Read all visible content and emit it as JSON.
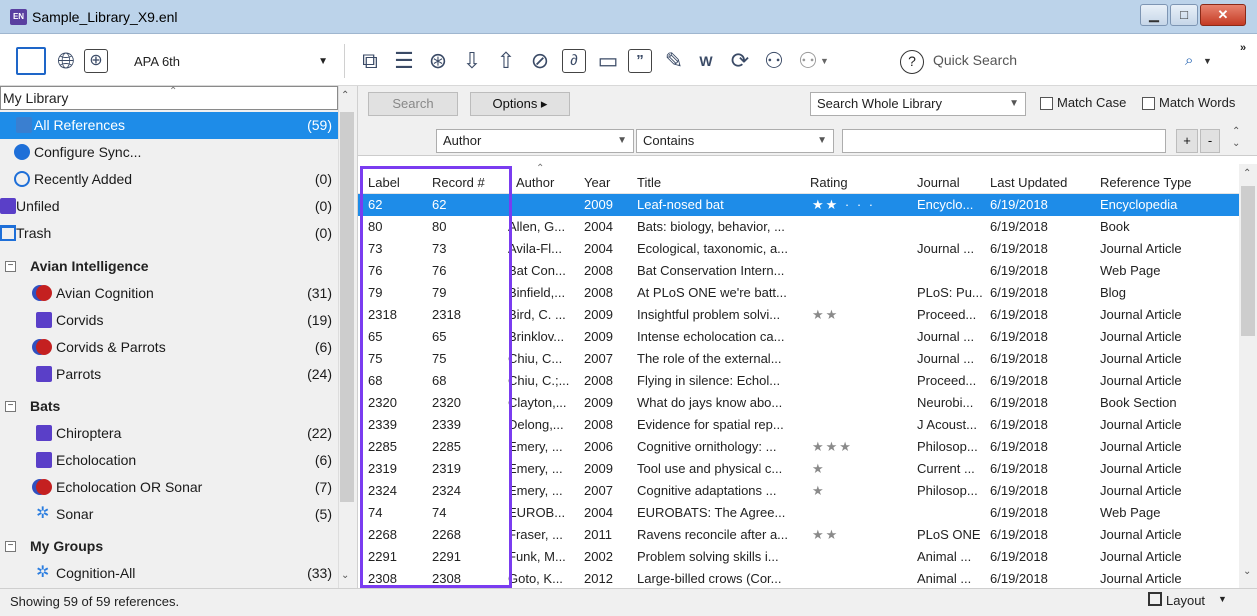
{
  "window": {
    "title": "Sample_Library_X9.enl",
    "app_badge": "EN"
  },
  "toolbar": {
    "style": "APA 6th",
    "quick_search_label": "Quick Search",
    "icons": [
      "local-library-icon",
      "online-search-icon",
      "integrated-library-icon",
      "copy-to-library-icon",
      "new-reference-icon",
      "find-full-text-icon",
      "import-icon",
      "export-icon",
      "online-search-find-icon",
      "open-link-icon",
      "open-file-icon",
      "insert-citation-icon",
      "format-bibliography-icon",
      "word-icon",
      "sync-icon",
      "share-library-icon",
      "manage-groups-icon",
      "help-icon",
      "search-icon"
    ]
  },
  "sidebar": {
    "library_select": "My Library",
    "items": [
      {
        "label": "All References",
        "count": "(59)",
        "icon": "all-references-icon"
      },
      {
        "label": "Configure Sync...",
        "count": "",
        "icon": "sync-icon"
      },
      {
        "label": "Recently Added",
        "count": "(0)",
        "icon": "clock-icon"
      },
      {
        "label": "Unfiled",
        "count": "(0)",
        "icon": "group-icon"
      },
      {
        "label": "Trash",
        "count": "(0)",
        "icon": "trash-icon"
      }
    ],
    "groups": [
      {
        "label": "Avian Intelligence",
        "items": [
          {
            "label": "Avian Cognition",
            "count": "(31)",
            "icon": "smart-group-icon"
          },
          {
            "label": "Corvids",
            "count": "(19)",
            "icon": "group-icon"
          },
          {
            "label": "Corvids & Parrots",
            "count": "(6)",
            "icon": "smart-group-icon"
          },
          {
            "label": "Parrots",
            "count": "(24)",
            "icon": "group-icon"
          }
        ]
      },
      {
        "label": "Bats",
        "items": [
          {
            "label": "Chiroptera",
            "count": "(22)",
            "icon": "group-icon"
          },
          {
            "label": "Echolocation",
            "count": "(6)",
            "icon": "group-icon"
          },
          {
            "label": "Echolocation OR Sonar",
            "count": "(7)",
            "icon": "smart-group-icon"
          },
          {
            "label": "Sonar",
            "count": "(5)",
            "icon": "gear-icon"
          }
        ]
      },
      {
        "label": "My Groups",
        "items": [
          {
            "label": "Cognition-All",
            "count": "(33)",
            "icon": "gear-icon"
          }
        ]
      }
    ]
  },
  "search": {
    "search_button": "Search",
    "options_button": "Options ▸",
    "scope": "Search Whole Library",
    "match_case": "Match Case",
    "match_words": "Match Words",
    "field": "Author",
    "operator": "Contains",
    "value": "",
    "add": "+",
    "remove": "-"
  },
  "table": {
    "columns": [
      "Label",
      "Record #",
      "Author",
      "Year",
      "Title",
      "Rating",
      "Journal",
      "Last Updated",
      "Reference Type"
    ],
    "rows": [
      [
        "62",
        "62",
        "",
        "2009",
        "Leaf-nosed bat",
        "★★ · · ·",
        "Encyclo...",
        "6/19/2018",
        "Encyclopedia"
      ],
      [
        "80",
        "80",
        "Allen, G...",
        "2004",
        "Bats: biology, behavior, ...",
        "",
        "",
        "6/19/2018",
        "Book"
      ],
      [
        "73",
        "73",
        "Avila-Fl...",
        "2004",
        "Ecological, taxonomic, a...",
        "",
        "Journal ...",
        "6/19/2018",
        "Journal Article"
      ],
      [
        "76",
        "76",
        "Bat Con...",
        "2008",
        "Bat Conservation Intern...",
        "",
        "",
        "6/19/2018",
        "Web Page"
      ],
      [
        "79",
        "79",
        "Binfield,...",
        "2008",
        "At PLoS ONE we're batt...",
        "",
        "PLoS: Pu...",
        "6/19/2018",
        "Blog"
      ],
      [
        "2318",
        "2318",
        "Bird, C. ...",
        "2009",
        "Insightful problem solvi...",
        "★★",
        "Proceed...",
        "6/19/2018",
        "Journal Article"
      ],
      [
        "65",
        "65",
        "Brinklov...",
        "2009",
        "Intense echolocation ca...",
        "",
        "Journal ...",
        "6/19/2018",
        "Journal Article"
      ],
      [
        "75",
        "75",
        "Chiu, C...",
        "2007",
        "The role of the external...",
        "",
        "Journal ...",
        "6/19/2018",
        "Journal Article"
      ],
      [
        "68",
        "68",
        "Chiu, C.;...",
        "2008",
        "Flying in silence: Echol...",
        "",
        "Proceed...",
        "6/19/2018",
        "Journal Article"
      ],
      [
        "2320",
        "2320",
        "Clayton,...",
        "2009",
        "What do jays know abo...",
        "",
        "Neurobi...",
        "6/19/2018",
        "Book Section"
      ],
      [
        "2339",
        "2339",
        "Delong,...",
        "2008",
        "Evidence for spatial rep...",
        "",
        "J Acoust...",
        "6/19/2018",
        "Journal Article"
      ],
      [
        "2285",
        "2285",
        "Emery, ...",
        "2006",
        "Cognitive ornithology: ...",
        "★★★",
        "Philosop...",
        "6/19/2018",
        "Journal Article"
      ],
      [
        "2319",
        "2319",
        "Emery, ...",
        "2009",
        "Tool use and physical c...",
        "★",
        "Current ...",
        "6/19/2018",
        "Journal Article"
      ],
      [
        "2324",
        "2324",
        "Emery, ...",
        "2007",
        "Cognitive adaptations ...",
        "★",
        "Philosop...",
        "6/19/2018",
        "Journal Article"
      ],
      [
        "74",
        "74",
        "EUROB...",
        "2004",
        "EUROBATS: The Agree...",
        "",
        "",
        "6/19/2018",
        "Web Page"
      ],
      [
        "2268",
        "2268",
        "Fraser, ...",
        "2011",
        "Ravens reconcile after a...",
        "★★",
        "PLoS ONE",
        "6/19/2018",
        "Journal Article"
      ],
      [
        "2291",
        "2291",
        "Funk, M...",
        "2002",
        "Problem solving skills i...",
        "",
        "Animal ...",
        "6/19/2018",
        "Journal Article"
      ],
      [
        "2308",
        "2308",
        "Goto, K...",
        "2012",
        "Large-billed crows (Cor...",
        "",
        "Animal ...",
        "6/19/2018",
        "Journal Article"
      ]
    ]
  },
  "status": {
    "text": "Showing 59 of 59 references.",
    "layout": "Layout"
  },
  "colors": {
    "accent": "#1e8ce8",
    "highlight": "#7a3cf0"
  }
}
